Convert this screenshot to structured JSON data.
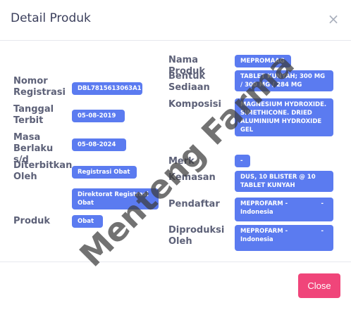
{
  "header": {
    "title": "Detail Produk",
    "close_icon": "close-icon"
  },
  "left": {
    "nomor_registrasi_label": "Nomor Registrasi",
    "nomor_registrasi_value": "DBL7815613063A1",
    "tanggal_terbit_label": "Tanggal Terbit",
    "tanggal_terbit_value": "05-08-2019",
    "masa_berlaku_label": "Masa Berlaku s/d",
    "masa_berlaku_value": "05-08-2024",
    "diterbitkan_oleh_label": "Diterbitkan Oleh",
    "diterbitkan_oleh_value": "Registrasi Obat",
    "direktorat_value": "Direktorat Registrasi Obat",
    "produk_label": "Produk",
    "produk_value": "Obat"
  },
  "right": {
    "nama_produk_label": "Nama Produk",
    "nama_produk_value": "MEPROMAAG",
    "bentuk_sediaan_label": "Bentuk Sediaan",
    "bentuk_sediaan_value": "TABLET KUNYAH; 300 MG / 300 MG / 284 MG",
    "komposisi_label": "Komposisi",
    "komposisi_value": "MAGNESIUM HYDROXIDE. SIMETHICONE. DRIED ALUMINIUM HYDROXIDE GEL",
    "merk_label": "Merk",
    "merk_value": "-",
    "kemasan_label": "Kemasan",
    "kemasan_value": "DUS, 10 BLISTER @ 10 TABLET KUNYAH",
    "pendaftar_label": "Pendaftar",
    "pendaftar_value": "MEPROFARM - Indonesia",
    "pendaftar_dash": "-",
    "diproduksi_oleh_label": "Diproduksi Oleh",
    "diproduksi_oleh_value": "MEPROFARM - Indonesia",
    "diproduksi_dash": "-"
  },
  "footer": {
    "close_label": "Close"
  },
  "watermark": "Menteng Farma",
  "colors": {
    "badge": "#5b7bf0",
    "close_button": "#f0457a"
  }
}
